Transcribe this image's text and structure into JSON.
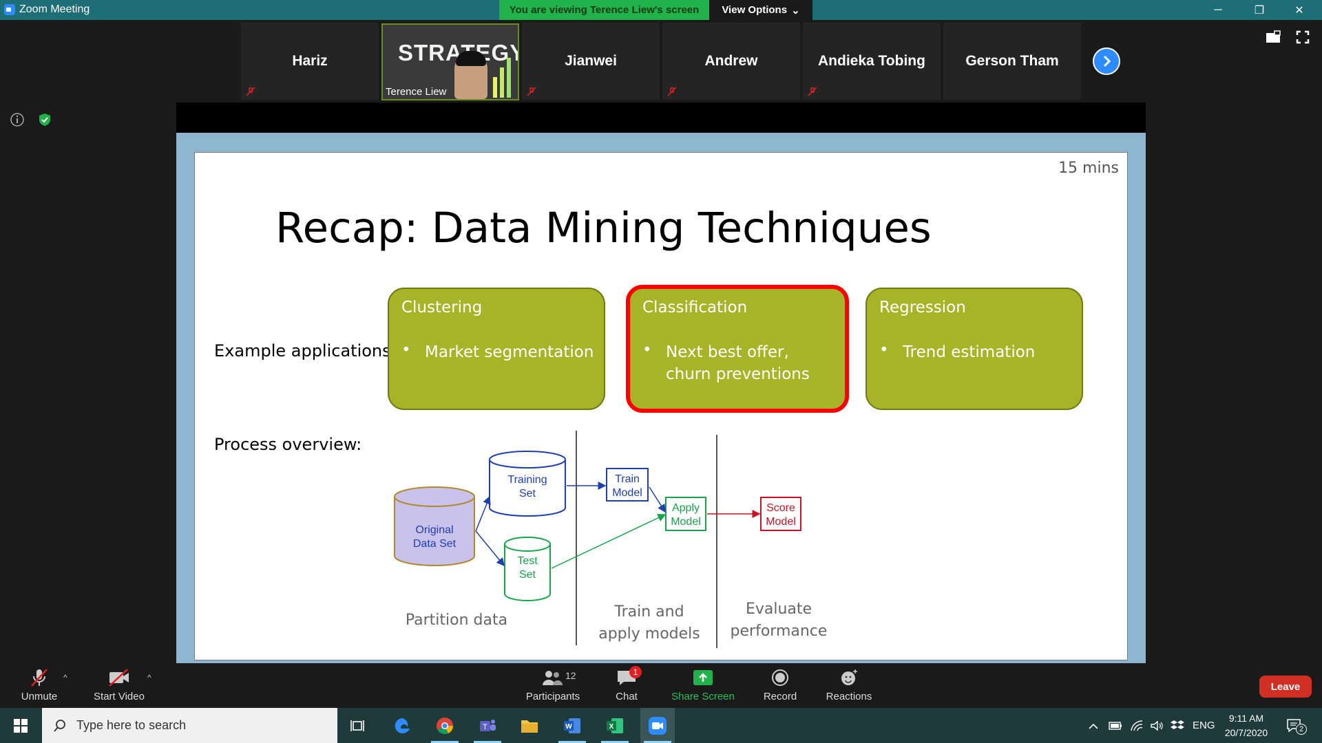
{
  "window": {
    "title": "Zoom Meeting",
    "viewing_banner": "You are viewing Terence Liew's screen",
    "view_options": "View Options",
    "controls": {
      "minimize": "─",
      "restore": "❐",
      "close": "✕"
    }
  },
  "gallery": {
    "participants": [
      {
        "name": "Hariz",
        "muted": true
      },
      {
        "name": "Jianwei",
        "muted": true
      },
      {
        "name": "Andrew",
        "muted": true
      },
      {
        "name": "Andieka Tobing",
        "muted": true
      },
      {
        "name": "Gerson Tham",
        "muted": false
      }
    ],
    "active_speaker": {
      "name": "Terence Liew",
      "background_word": "STRATEGY"
    }
  },
  "slide": {
    "timer": "15 mins",
    "title": "Recap: Data Mining Techniques",
    "example_label": "Example applications:",
    "process_label": "Process overview:",
    "techniques": [
      {
        "heading": "Clustering",
        "bullet": "Market segmentation",
        "selected": false
      },
      {
        "heading": "Classification",
        "bullet": "Next best offer, churn preventions",
        "selected": true
      },
      {
        "heading": "Regression",
        "bullet": "Trend estimation",
        "selected": false
      }
    ],
    "flow": {
      "original_line1": "Original",
      "original_line2": "Data Set",
      "training_line1": "Training",
      "training_line2": "Set",
      "test_line1": "Test",
      "test_line2": "Set",
      "train_line1": "Train",
      "train_line2": "Model",
      "apply_line1": "Apply",
      "apply_line2": "Model",
      "score_line1": "Score",
      "score_line2": "Model",
      "stage1": "Partition data",
      "stage2_line1": "Train and",
      "stage2_line2": "apply models",
      "stage3_line1": "Evaluate",
      "stage3_line2": "performance"
    },
    "colors": {
      "box_fill": "#a7b428",
      "selected_border": "#ff0000",
      "blue": "#1f3fae",
      "green": "#16a34a",
      "red": "#cc1122"
    }
  },
  "toolbar": {
    "unmute": "Unmute",
    "start_video": "Start Video",
    "participants": "Participants",
    "participants_count": "12",
    "chat": "Chat",
    "chat_badge": "1",
    "share_screen": "Share Screen",
    "record": "Record",
    "reactions": "Reactions",
    "leave": "Leave"
  },
  "taskbar": {
    "search_placeholder": "Type here to search",
    "language": "ENG",
    "time": "9:11 AM",
    "date": "20/7/2020",
    "notification_count": "2"
  }
}
